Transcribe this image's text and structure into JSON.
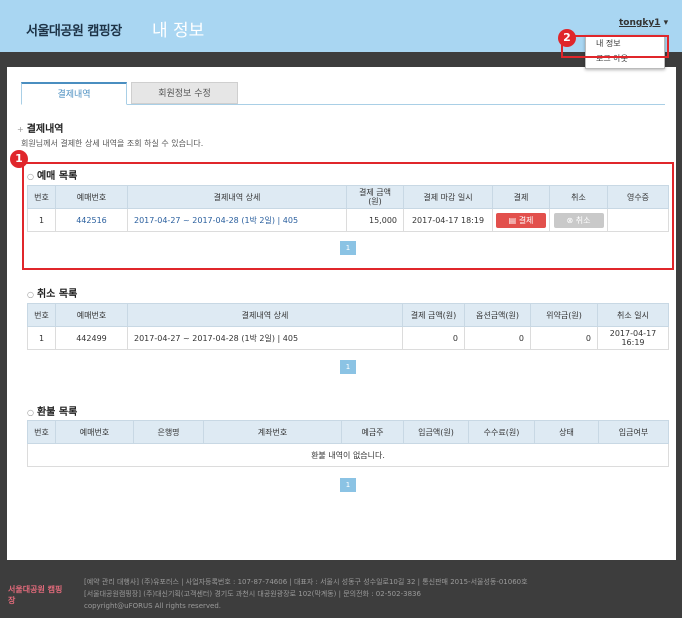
{
  "header": {
    "logo": "서울대공원 캠핑장",
    "title": "내 정보",
    "user": "tongky1",
    "user_caret": "▾",
    "menu": [
      "내 정보",
      "로그 아웃"
    ]
  },
  "annotations": [
    "1",
    "2"
  ],
  "tabs": [
    "결제내역",
    "회원정보 수정"
  ],
  "section": {
    "title": "결제내역",
    "description": "회원님께서 결제한 상세 내역을 조회 하실 수 있습니다."
  },
  "reservations": {
    "title": "예매 목록",
    "headers": [
      "번호",
      "예매번호",
      "결제내역 상세",
      "결제 금액\n(원)",
      "결제 마감 일시",
      "결제",
      "취소",
      "영수증"
    ],
    "row": {
      "no": "1",
      "id": "442516",
      "detail": "2017-04-27 ~ 2017-04-28 (1박 2일) | 405",
      "amount": "15,000",
      "deadline": "2017-04-17 18:19",
      "pay_label": "결제",
      "cancel_label": "취소"
    },
    "page": "1"
  },
  "cancellations": {
    "title": "취소 목록",
    "headers": [
      "번호",
      "예매번호",
      "결제내역 상세",
      "결제 금액(원)",
      "옵션금액(원)",
      "위약금(원)",
      "취소 일시"
    ],
    "row": {
      "no": "1",
      "id": "442499",
      "detail": "2017-04-27 ~ 2017-04-28 (1박 2일) | 405",
      "amount": "0",
      "option": "0",
      "penalty": "0",
      "date": "2017-04-17\n16:19"
    },
    "page": "1"
  },
  "refunds": {
    "title": "환불 목록",
    "headers": [
      "번호",
      "예매번호",
      "은행명",
      "계좌번호",
      "예금주",
      "입금액(원)",
      "수수료(원)",
      "상태",
      "입금여부"
    ],
    "empty": "환불 내역이 없습니다.",
    "page": "1"
  },
  "footer": {
    "logo": "서울대공원 캠핑장",
    "line1": "[예약 관리 대행사] (주)유포러스 | 사업자등록번호 : 107-87-74606 | 대표자 : 서울시 성동구 성수일로10길 32 | 통신판매 2015-서울성동-01060호",
    "line2": "[서울대공원캠핑장] (주)대신기획(고객센터) 경기도 과천시 대공원광장로 102(막계동) | 문의전화 : 02-502-3836",
    "line3": "copyright@uFORUS All rights reserved."
  }
}
